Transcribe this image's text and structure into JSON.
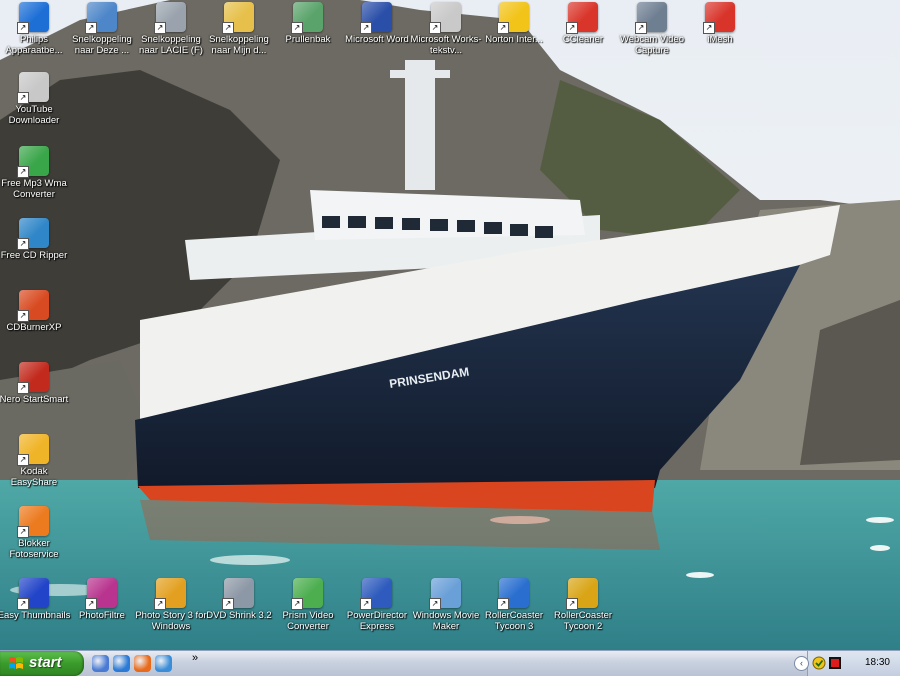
{
  "desktop": {
    "icons_top": [
      {
        "label": "Philips Apparaatbe...",
        "icon": "philips-icon",
        "color": "#1d6fd6"
      },
      {
        "label": "Snelkoppeling naar Deze ...",
        "icon": "computer-icon",
        "color": "#4d86c9"
      },
      {
        "label": "Snelkoppeling naar LACIE (F)",
        "icon": "drive-icon",
        "color": "#9aa3ad"
      },
      {
        "label": "Snelkoppeling naar Mijn d...",
        "icon": "folder-icon",
        "color": "#e6c04a"
      },
      {
        "label": "Prullenbak",
        "icon": "recycle-bin-icon",
        "color": "#5aa36b"
      },
      {
        "label": "Microsoft Word",
        "icon": "word-icon",
        "color": "#2a4fa8"
      },
      {
        "label": "Microsoft Works-tekstv...",
        "icon": "works-icon",
        "color": "#c9c9c9"
      },
      {
        "label": "Norton Inter...",
        "icon": "norton-icon",
        "color": "#f2c318"
      },
      {
        "label": "CCleaner",
        "icon": "ccleaner-icon",
        "color": "#d9352a"
      },
      {
        "label": "Webcam Video Capture",
        "icon": "webcam-icon",
        "color": "#6f7f92"
      },
      {
        "label": "iMesh",
        "icon": "imesh-icon",
        "color": "#d8342a"
      }
    ],
    "icons_left": [
      {
        "label": "YouTube Downloader",
        "icon": "youtube-downloader-icon",
        "color": "#c8c8c8"
      },
      {
        "label": "Free Mp3 Wma Converter",
        "icon": "mp3-converter-icon",
        "color": "#3aa64a"
      },
      {
        "label": "Free CD Ripper",
        "icon": "cd-ripper-icon",
        "color": "#2f86c8"
      },
      {
        "label": "CDBurnerXP",
        "icon": "cdburner-icon",
        "color": "#d84b22"
      },
      {
        "label": "Nero StartSmart",
        "icon": "nero-icon",
        "color": "#c22a1d"
      },
      {
        "label": "Kodak EasyShare",
        "icon": "kodak-icon",
        "color": "#f0b428"
      },
      {
        "label": "Blokker Fotoservice",
        "icon": "blokker-icon",
        "color": "#ec7a1e"
      }
    ],
    "icons_bottom": [
      {
        "label": "Easy Thumbnails",
        "icon": "easy-thumbnails-icon",
        "color": "#2244c8"
      },
      {
        "label": "PhotoFiltre",
        "icon": "photofiltre-icon",
        "color": "#b8348e"
      },
      {
        "label": "Photo Story 3 for Windows",
        "icon": "photo-story-icon",
        "color": "#e3a020"
      },
      {
        "label": "DVD Shrink 3.2",
        "icon": "dvd-shrink-icon",
        "color": "#8d98a6"
      },
      {
        "label": "Prism Video Converter",
        "icon": "prism-icon",
        "color": "#4cae4f"
      },
      {
        "label": "PowerDirector Express",
        "icon": "powerdirector-icon",
        "color": "#2e5bbd"
      },
      {
        "label": "Windows Movie Maker",
        "icon": "movie-maker-icon",
        "color": "#6aa0d8"
      },
      {
        "label": "RollerCoaster Tycoon 3",
        "icon": "rct3-icon",
        "color": "#2a6fd0"
      },
      {
        "label": "RollerCoaster Tycoon 2",
        "icon": "rct2-icon",
        "color": "#d9a516"
      }
    ],
    "wallpaper": {
      "ship_name": "PRINSENDAM"
    }
  },
  "taskbar": {
    "start_label": "start",
    "quicklaunch": [
      {
        "icon": "show-desktop-icon",
        "color": "#4a7bd4"
      },
      {
        "icon": "internet-explorer-icon",
        "color": "#2a7ad6"
      },
      {
        "icon": "firefox-icon",
        "color": "#e86a1a"
      },
      {
        "icon": "media-player-icon",
        "color": "#3a8dd8"
      }
    ],
    "chevron": "»",
    "tray_toggle": "‹",
    "clock": "18:30"
  }
}
